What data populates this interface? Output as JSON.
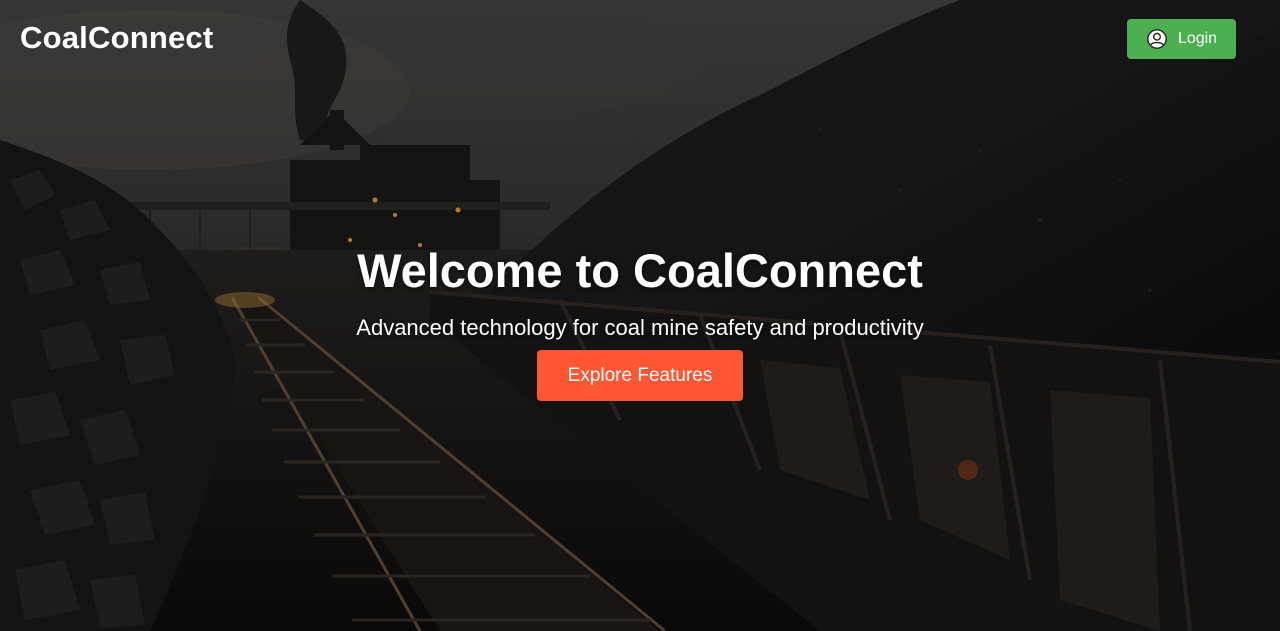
{
  "header": {
    "brand": "CoalConnect",
    "login": {
      "label": "Login",
      "icon": "user-circle-icon",
      "color": "#4caf50"
    }
  },
  "hero": {
    "title": "Welcome to CoalConnect",
    "subtitle": "Advanced technology for coal mine safety and productivity",
    "cta": {
      "label": "Explore Features",
      "color": "#ff5733"
    },
    "background_image": "coal mine railway with coal wagons and processing plant"
  }
}
